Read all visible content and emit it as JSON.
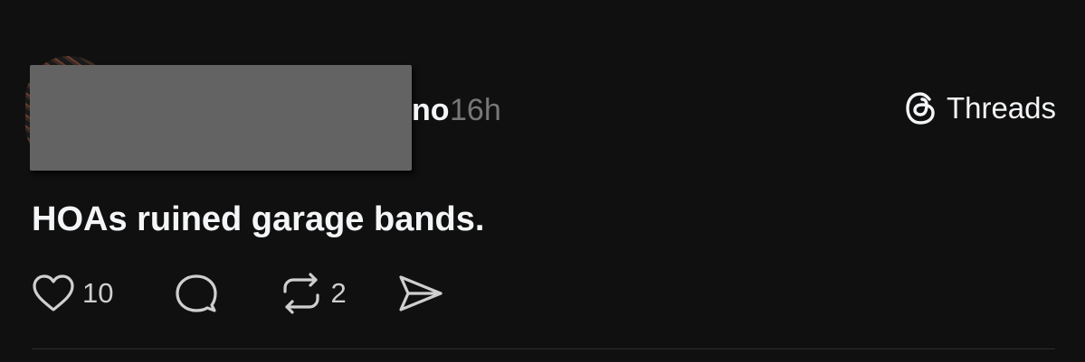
{
  "post": {
    "author_visible_fragment": "no",
    "timestamp": "16h",
    "text": "HOAs ruined garage bands.",
    "brand": {
      "label": "Threads",
      "icon": "threads-logo-icon"
    },
    "actions": {
      "like": {
        "icon": "heart-icon",
        "count": "10"
      },
      "reply": {
        "icon": "speech-bubble-icon"
      },
      "repost": {
        "icon": "repost-arrows-icon",
        "count": "2"
      },
      "share": {
        "icon": "send-icon"
      }
    }
  },
  "colors": {
    "background": "#101010",
    "text_primary": "#f3f5f7",
    "text_secondary": "#777777",
    "redaction": "#636363"
  }
}
